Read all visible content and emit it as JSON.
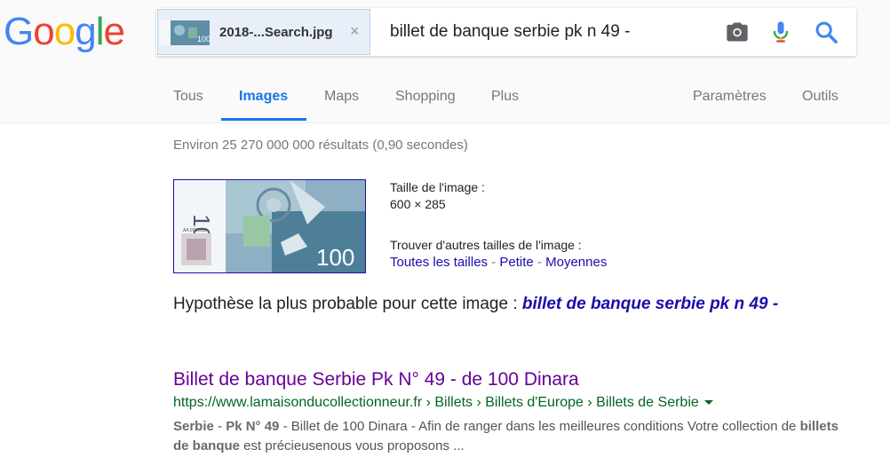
{
  "logo": {
    "letters": [
      "G",
      "o",
      "o",
      "g",
      "l",
      "e"
    ],
    "colors": [
      "#4285F4",
      "#EA4335",
      "#FBBC05",
      "#4285F4",
      "#34A853",
      "#EA4335"
    ]
  },
  "search": {
    "image_chip": {
      "filename": "2018-...Search.jpg",
      "thumb_text": "100",
      "close": "×"
    },
    "query": "billet de banque serbie pk n 49 -",
    "icons": [
      "camera-icon",
      "microphone-icon",
      "search-icon"
    ]
  },
  "tabs": {
    "items": [
      "Tous",
      "Images",
      "Maps",
      "Shopping",
      "Plus"
    ],
    "active": "Images",
    "right": [
      "Paramètres",
      "Outils"
    ]
  },
  "results_stats": "Environ 25 270 000 000 résultats (0,90 secondes)",
  "image_info": {
    "size_label": "Taille de l'image :",
    "size_value": "600 × 285",
    "other_sizes_label": "Trouver d'autres tailles de l'image :",
    "links": [
      "Toutes les tailles",
      "Petite",
      "Moyennes"
    ],
    "separator": "-",
    "banknote_value": "100",
    "banknote_serial": "AA 0000112"
  },
  "best_guess": {
    "prefix": "Hypothèse la plus probable pour cette image : ",
    "query": "billet de banque serbie pk n 49 -"
  },
  "result": {
    "title": "Billet de banque Serbie Pk N° 49 - de 100 Dinara",
    "url": "https://www.lamaisonducollectionneur.fr › Billets › Billets d'Europe › Billets de Serbie",
    "snippet": {
      "b1": "Serbie",
      "t1": " - ",
      "b2": "Pk N° 49",
      "t2": " - Billet de 100 Dinara - Afin de ranger dans les meilleures conditions Votre collection de ",
      "b3": "billets de banque",
      "t3": " est précieusenous vous proposons ..."
    }
  },
  "colors": {
    "tab_active": "#1a73e8",
    "link": "#1a0dab",
    "visited": "#660099",
    "url": "#006621"
  }
}
